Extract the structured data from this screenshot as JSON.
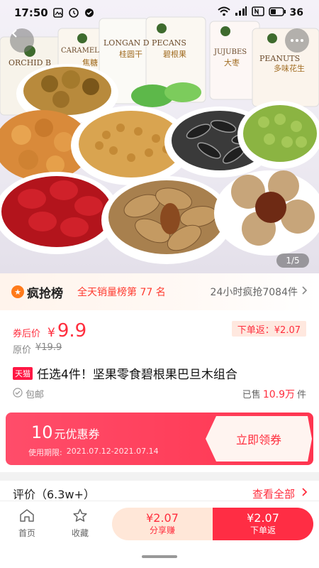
{
  "status_bar": {
    "time": "17:50",
    "battery": "36"
  },
  "hero": {
    "page_indicator": "1/5",
    "packages": [
      "ORCHID B",
      "CARAMEL",
      "LONGAN D",
      "PECANS",
      "JUJUBES",
      "PEANUTS"
    ],
    "package_cn": [
      "焦糖",
      "桂圆干",
      "碧根果",
      "大枣",
      "多味花生"
    ]
  },
  "ranking": {
    "logo": "疯抢榜",
    "rank_text": "全天销量榜第 77 名",
    "sales_24h": "24小时疯抢7084件"
  },
  "price": {
    "label": "券后价",
    "symbol": "¥",
    "value": "9.9",
    "rebate": "下单返：¥2.07",
    "original_label": "原价",
    "original_value": "¥19.9"
  },
  "product": {
    "platform_tag": "天猫",
    "title": "任选4件！坚果零食碧根果巴旦木组合",
    "shipping": "包邮",
    "sold_label": "已售",
    "sold_count": "10.9万",
    "sold_unit": "件"
  },
  "coupon": {
    "amount": "10",
    "amount_text": "元优惠券",
    "period_label": "使用期限:",
    "period": "2021.07.12-2021.07.14",
    "claim_label": "立即领券"
  },
  "reviews": {
    "title": "评价（6.3w+）",
    "view_all": "查看全部"
  },
  "bottom_bar": {
    "home_label": "首页",
    "favorite_label": "收藏",
    "share_amount": "¥2.07",
    "share_label": "分享赚",
    "order_amount": "¥2.07",
    "order_label": "下单返"
  },
  "colors": {
    "accent": "#ff2d3d",
    "coupon": "#ff3550",
    "rank_orange": "#ff7a1a"
  }
}
